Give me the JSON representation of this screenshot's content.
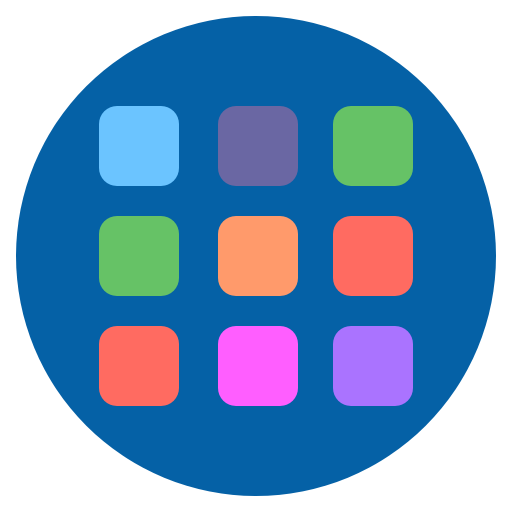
{
  "icon": {
    "name": "app-grid-icon",
    "background_color": "#0561A6",
    "tiles": [
      {
        "name": "tile-light-blue",
        "color": "#6BC4FF"
      },
      {
        "name": "tile-slate-purple",
        "color": "#6A67A3"
      },
      {
        "name": "tile-green",
        "color": "#66C266"
      },
      {
        "name": "tile-green",
        "color": "#66C266"
      },
      {
        "name": "tile-orange",
        "color": "#FF9A6B"
      },
      {
        "name": "tile-coral",
        "color": "#FF6B61"
      },
      {
        "name": "tile-coral",
        "color": "#FF6B61"
      },
      {
        "name": "tile-magenta",
        "color": "#FF5EFF"
      },
      {
        "name": "tile-violet",
        "color": "#AA73FF"
      }
    ]
  }
}
